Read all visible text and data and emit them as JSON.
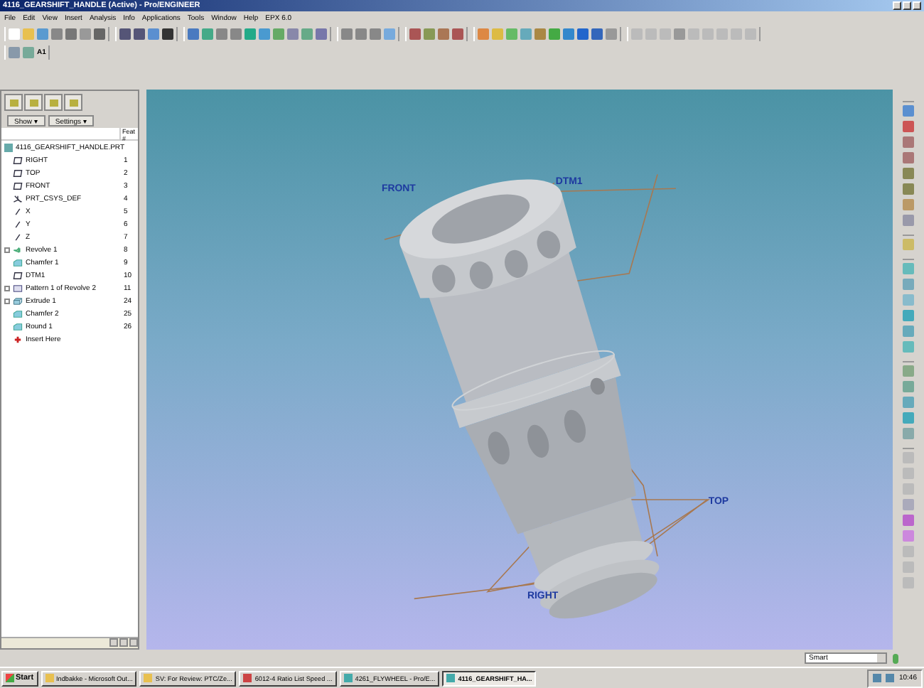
{
  "window": {
    "title": "4116_GEARSHIFT_HANDLE (Active) - Pro/ENGINEER"
  },
  "menu": [
    "File",
    "Edit",
    "View",
    "Insert",
    "Analysis",
    "Info",
    "Applications",
    "Tools",
    "Window",
    "Help",
    "EPX 6.0"
  ],
  "toolbar2": {
    "label": "A1"
  },
  "model_tree": {
    "show_button": "Show ▾",
    "settings_button": "Settings ▾",
    "column": "Feat #",
    "root": {
      "label": "4116_GEARSHIFT_HANDLE.PRT",
      "children": [
        {
          "label": "RIGHT",
          "feat": "1",
          "kind": "plane",
          "collapsed": false
        },
        {
          "label": "TOP",
          "feat": "2",
          "kind": "plane",
          "collapsed": false
        },
        {
          "label": "FRONT",
          "feat": "3",
          "kind": "plane",
          "collapsed": false
        },
        {
          "label": "PRT_CSYS_DEF",
          "feat": "4",
          "kind": "csys",
          "collapsed": false
        },
        {
          "label": "X",
          "feat": "5",
          "kind": "axis",
          "collapsed": false
        },
        {
          "label": "Y",
          "feat": "6",
          "kind": "axis",
          "collapsed": false
        },
        {
          "label": "Z",
          "feat": "7",
          "kind": "axis",
          "collapsed": false
        },
        {
          "label": "Revolve 1",
          "feat": "8",
          "kind": "revolve",
          "collapsed": true
        },
        {
          "label": "Chamfer 1",
          "feat": "9",
          "kind": "chamfer",
          "collapsed": false
        },
        {
          "label": "DTM1",
          "feat": "10",
          "kind": "plane",
          "collapsed": false
        },
        {
          "label": "Pattern 1 of Revolve 2",
          "feat": "11",
          "kind": "pattern",
          "collapsed": true
        },
        {
          "label": "Extrude 1",
          "feat": "24",
          "kind": "extrude",
          "collapsed": true
        },
        {
          "label": "Chamfer 2",
          "feat": "25",
          "kind": "chamfer",
          "collapsed": false
        },
        {
          "label": "Round 1",
          "feat": "26",
          "kind": "round",
          "collapsed": false
        },
        {
          "label": "Insert Here",
          "kind": "insert",
          "collapsed": false
        }
      ]
    }
  },
  "viewport": {
    "datum_labels": [
      "FRONT",
      "DTM1",
      "TOP",
      "RIGHT"
    ]
  },
  "status_bar": {
    "filter": "Smart"
  },
  "taskbar": {
    "start": "Start",
    "clock": "10:46",
    "tasks": [
      {
        "label": "Indbakke - Microsoft Out...",
        "kind": "mail",
        "selected": false
      },
      {
        "label": "SV: For Review: PTC/Ze...",
        "kind": "mail",
        "selected": false
      },
      {
        "label": "6012-4 Ratio List  Speed ...",
        "kind": "sheet",
        "selected": false
      },
      {
        "label": "4261_FLYWHEEL - Pro/E...",
        "kind": "cad",
        "selected": false
      },
      {
        "label": "4116_GEARSHIFT_HA...",
        "kind": "cad",
        "selected": true
      }
    ]
  }
}
